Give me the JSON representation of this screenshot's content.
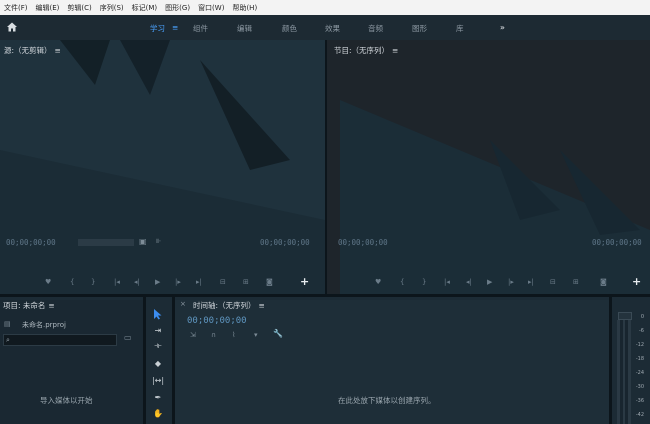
{
  "menu": [
    "文件(F)",
    "编辑(E)",
    "剪辑(C)",
    "序列(S)",
    "标记(M)",
    "图形(G)",
    "窗口(W)",
    "帮助(H)"
  ],
  "workspaces": {
    "items": [
      "学习",
      "组件",
      "编辑",
      "颜色",
      "效果",
      "音频",
      "图形",
      "库"
    ],
    "active": "学习",
    "more": "»"
  },
  "source_monitor": {
    "title": "源:（无剪辑）",
    "timecode_left": "00;00;00;00",
    "timecode_right": "00;00;00;00"
  },
  "program_monitor": {
    "title": "节目:（无序列）",
    "timecode_left": "00;00;00;00",
    "timecode_right": "00;00;00;00"
  },
  "project": {
    "title": "项目: 未命名",
    "file": "未命名.prproj",
    "search_placeholder": "",
    "empty_text": "导入媒体以开始"
  },
  "timeline": {
    "title": "时间轴:（无序列）",
    "timecode": "00;00;00;00",
    "empty_text": "在此处放下媒体以创建序列。"
  },
  "meter": {
    "labels": [
      "0",
      "-6",
      "-12",
      "-18",
      "-24",
      "-30",
      "-36",
      "-42"
    ]
  },
  "colors": {
    "accent": "#4aa3ff",
    "menu_bg": "#f3f3f3",
    "panel_bg": "#18252f"
  },
  "icons": {
    "home": "home-icon",
    "tools": [
      "selection-tool-icon",
      "track-select-tool-icon",
      "ripple-edit-tool-icon",
      "razor-tool-icon",
      "slip-tool-icon",
      "pen-tool-icon",
      "hand-tool-icon"
    ]
  }
}
